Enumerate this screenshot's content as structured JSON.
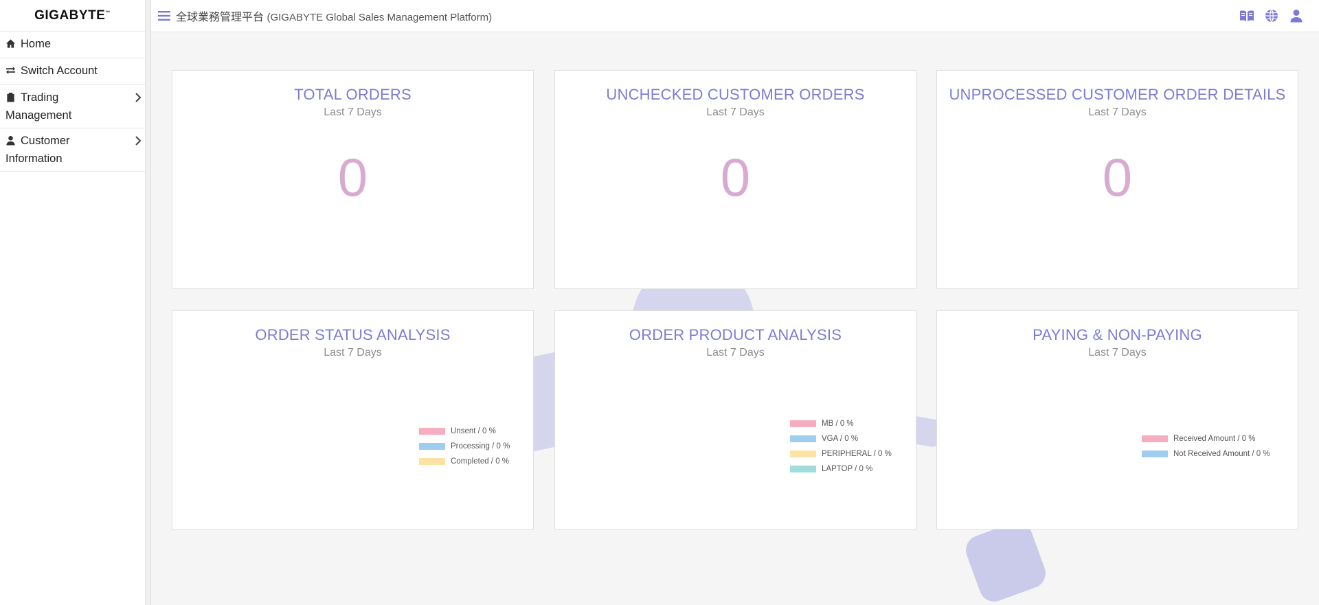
{
  "sidebar": {
    "logo": "GIGABYTE",
    "logo_tm": "™",
    "items": [
      {
        "label": "Home",
        "icon": "home-icon",
        "has_children": false
      },
      {
        "label": "Switch Account",
        "icon": "switch-icon",
        "has_children": false
      },
      {
        "label": "Trading Management",
        "icon": "clipboard-icon",
        "has_children": true
      },
      {
        "label": "Customer Information",
        "icon": "user-icon",
        "has_children": true
      }
    ]
  },
  "header": {
    "title_cn": "全球業務管理平台",
    "title_en": "(GIGABYTE Global Sales Management Platform)",
    "icons": [
      "book-icon",
      "globe-icon",
      "user-icon"
    ]
  },
  "cards": {
    "total_orders": {
      "title": "TOTAL ORDERS",
      "subtitle": "Last 7 Days",
      "value": "0"
    },
    "unchecked_orders": {
      "title": "UNCHECKED CUSTOMER ORDERS",
      "subtitle": "Last 7 Days",
      "value": "0"
    },
    "unprocessed_details": {
      "title": "UNPROCESSED CUSTOMER ORDER DETAILS",
      "subtitle": "Last 7 Days",
      "value": "0"
    },
    "order_status": {
      "title": "ORDER STATUS ANALYSIS",
      "subtitle": "Last 7 Days",
      "legend": [
        {
          "label": "Unsent  / 0 %",
          "color": "#f7adc0"
        },
        {
          "label": "Processing / 0 %",
          "color": "#9fcdf0"
        },
        {
          "label": "Completed / 0 %",
          "color": "#fde3a3"
        }
      ]
    },
    "order_product": {
      "title": "ORDER PRODUCT ANALYSIS",
      "subtitle": "Last 7 Days",
      "legend": [
        {
          "label": "MB / 0 %",
          "color": "#f7adc0"
        },
        {
          "label": "VGA / 0 %",
          "color": "#9fcdf0"
        },
        {
          "label": "PERIPHERAL / 0 %",
          "color": "#fde3a3"
        },
        {
          "label": "LAPTOP / 0 %",
          "color": "#9fdcdc"
        }
      ]
    },
    "paying": {
      "title": "PAYING & NON-PAYING",
      "subtitle": "Last 7 Days",
      "legend": [
        {
          "label": "Received Amount  / 0 %",
          "color": "#f7adc0"
        },
        {
          "label": "Not Received Amount  / 0 %",
          "color": "#9fcdf0"
        }
      ]
    }
  },
  "colors": {
    "accent": "#7b7bd6",
    "number_gradient_start": "#b9b1e3",
    "number_gradient_end": "#f7a4bf"
  }
}
